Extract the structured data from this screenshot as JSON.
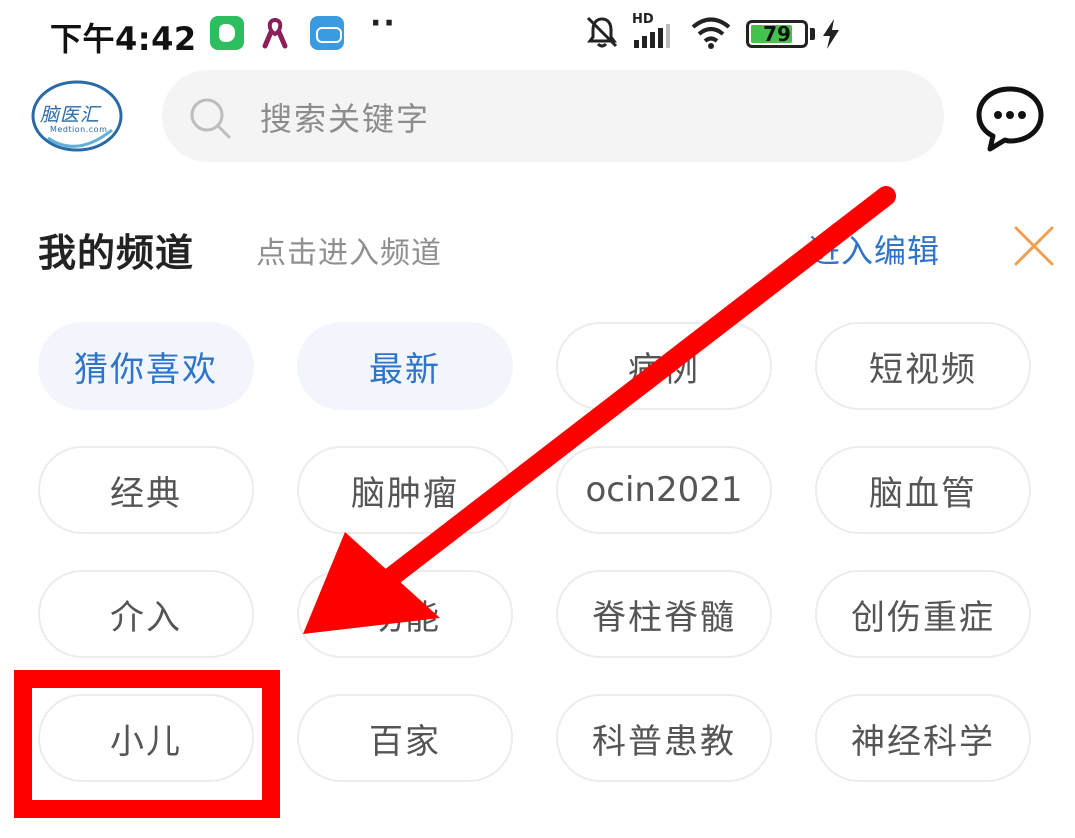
{
  "status_bar": {
    "time": "下午4:42",
    "battery_level": "79",
    "battery_fraction": 0.79,
    "network": "HD",
    "icons": [
      "evernote-icon",
      "ribbon-icon",
      "app-icon",
      "mute-bell-icon",
      "signal-icon",
      "wifi-icon",
      "battery-icon",
      "charging-icon"
    ]
  },
  "header": {
    "logo_text": "脑医汇",
    "logo_subtext": "Medtion.com",
    "search_placeholder": "搜索关键字",
    "chat_icon": "chat-bubble-icon"
  },
  "channels": {
    "title": "我的频道",
    "hint": "点击进入频道",
    "edit_label": "进入编辑",
    "close_icon": "close-icon",
    "items": [
      {
        "label": "猜你喜欢",
        "active": true
      },
      {
        "label": "最新",
        "active": true
      },
      {
        "label": "病例",
        "active": false
      },
      {
        "label": "短视频",
        "active": false
      },
      {
        "label": "经典",
        "active": false
      },
      {
        "label": "脑肿瘤",
        "active": false
      },
      {
        "label": "ocin2021",
        "active": false
      },
      {
        "label": "脑血管",
        "active": false
      },
      {
        "label": "介入",
        "active": false
      },
      {
        "label": "功能",
        "active": false
      },
      {
        "label": "脊柱脊髓",
        "active": false
      },
      {
        "label": "创伤重症",
        "active": false
      },
      {
        "label": "小儿",
        "active": false
      },
      {
        "label": "百家",
        "active": false
      },
      {
        "label": "科普患教",
        "active": false
      },
      {
        "label": "神经科学",
        "active": false
      }
    ]
  },
  "colors": {
    "accent": "#2e74c9",
    "active_chip_bg": "#f2f6fc",
    "annotation_red": "#ff0000",
    "close_orange": "#f0a050"
  }
}
